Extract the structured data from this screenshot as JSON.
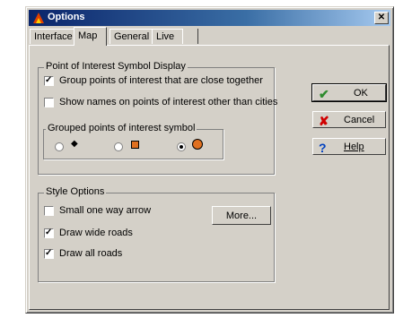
{
  "window": {
    "title": "Options"
  },
  "tabs": [
    {
      "label": "Interface"
    },
    {
      "label": "Map"
    },
    {
      "label": "General"
    },
    {
      "label": "Live"
    }
  ],
  "poi": {
    "group_title": "Point of Interest Symbol Display",
    "group_close_label": "Group points of interest that are close together",
    "group_close_checked": true,
    "show_names_label": "Show names on points of interest other than cities",
    "show_names_checked": false,
    "symbol_group_title": "Grouped points of interest symbol",
    "symbol_selected": 3
  },
  "style": {
    "group_title": "Style Options",
    "one_way_label": "Small one way arrow",
    "one_way_checked": false,
    "wide_roads_label": "Draw wide roads",
    "wide_roads_checked": true,
    "all_roads_label": "Draw all roads",
    "all_roads_checked": true,
    "more_button": "More..."
  },
  "buttons": {
    "ok": "OK",
    "cancel": "Cancel",
    "help": "Help"
  },
  "colors": {
    "ok_icon": "#2e8b2e",
    "cancel_icon": "#d00000",
    "help_icon": "#0040c0",
    "symbol_orange": "#e07020"
  }
}
